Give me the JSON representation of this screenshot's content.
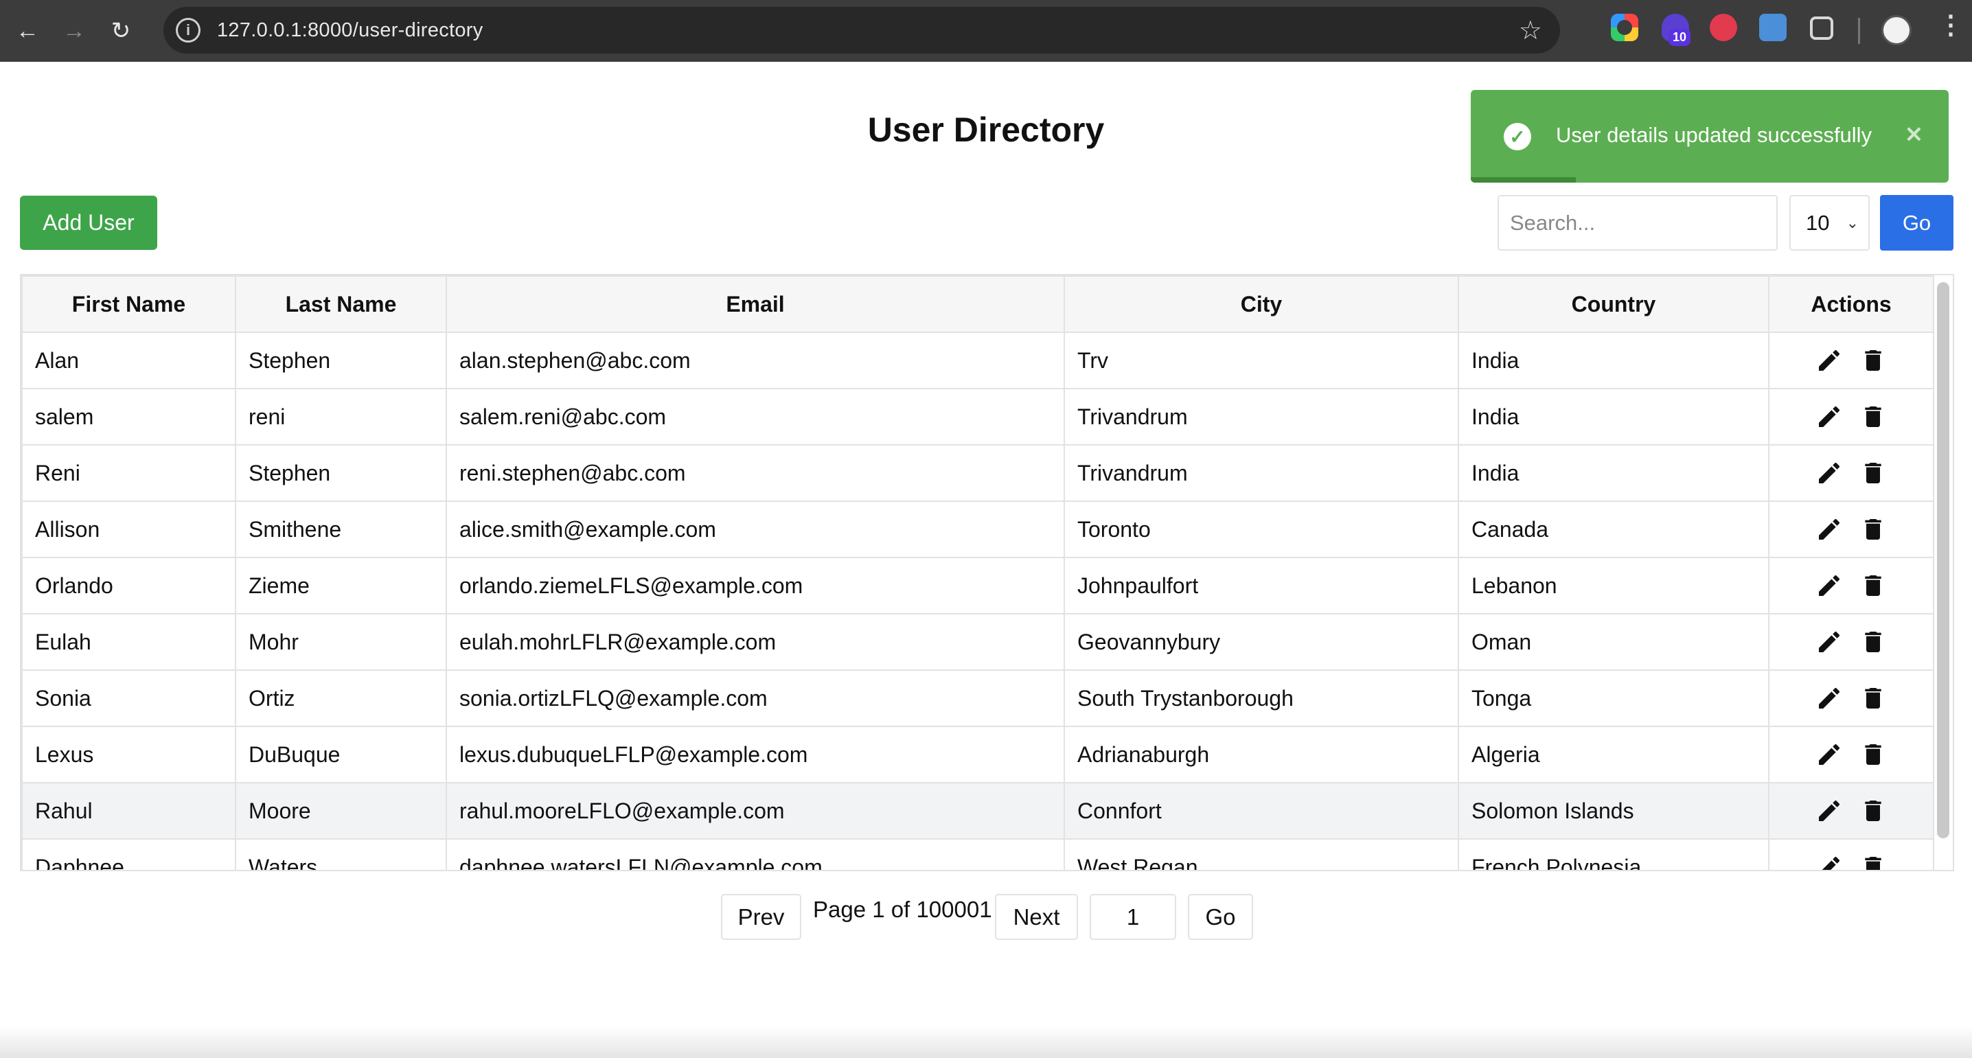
{
  "browser": {
    "url": "127.0.0.1:8000/user-directory",
    "back_icon": "←",
    "forward_icon": "→",
    "reload_icon": "↻",
    "info_icon": "i",
    "star_icon": "☆",
    "extension_badge": "10",
    "menu_icon": "⋮"
  },
  "page": {
    "title": "User Directory"
  },
  "toolbar": {
    "add_label": "Add User",
    "search_placeholder": "Search...",
    "page_size": "10",
    "go_label": "Go"
  },
  "toast": {
    "message": "User details updated successfully",
    "check_icon": "✓",
    "close_icon": "✕",
    "color": "#5cae52",
    "progress": 0.22
  },
  "table": {
    "columns": [
      "First Name",
      "Last Name",
      "Email",
      "City",
      "Country",
      "Actions"
    ],
    "rows": [
      [
        "Alan",
        "Stephen",
        "alan.stephen@abc.com",
        "Trv",
        "India"
      ],
      [
        "salem",
        "reni",
        "salem.reni@abc.com",
        "Trivandrum",
        "India"
      ],
      [
        "Reni",
        "Stephen",
        "reni.stephen@abc.com",
        "Trivandrum",
        "India"
      ],
      [
        "Allison",
        "Smithene",
        "alice.smith@example.com",
        "Toronto",
        "Canada"
      ],
      [
        "Orlando",
        "Zieme",
        "orlando.ziemeLFLS@example.com",
        "Johnpaulfort",
        "Lebanon"
      ],
      [
        "Eulah",
        "Mohr",
        "eulah.mohrLFLR@example.com",
        "Geovannybury",
        "Oman"
      ],
      [
        "Sonia",
        "Ortiz",
        "sonia.ortizLFLQ@example.com",
        "South Trystanborough",
        "Tonga"
      ],
      [
        "Lexus",
        "DuBuque",
        "lexus.dubuqueLFLP@example.com",
        "Adrianaburgh",
        "Algeria"
      ],
      [
        "Rahul",
        "Moore",
        "rahul.mooreLFLO@example.com",
        "Connfort",
        "Solomon Islands"
      ],
      [
        "Daphnee",
        "Waters",
        "daphnee.watersLFLN@example.com",
        "West Regan",
        "French Polynesia"
      ]
    ],
    "highlighted_row": 8,
    "edit_icon": "pencil-icon",
    "delete_icon": "trash-icon"
  },
  "pagination": {
    "prev_label": "Prev",
    "info": "Page 1 of 100001",
    "next_label": "Next",
    "page_input": "1",
    "go_label": "Go"
  },
  "colors": {
    "add_button": "#3ea449",
    "go_button": "#2b6fe6"
  }
}
